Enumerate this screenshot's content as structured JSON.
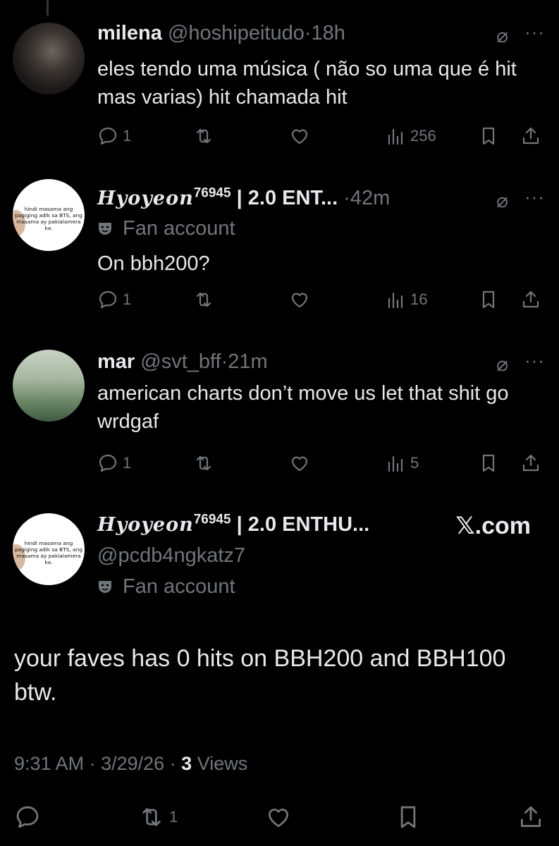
{
  "tweets": [
    {
      "name": "milena",
      "handle": "@hoshipeitudo",
      "sep": "·",
      "time": "18h",
      "text": "eles tendo uma música ( não so uma que é hit mas varias) hit chamada hit",
      "replies": "1",
      "reposts": "",
      "views": "256"
    },
    {
      "name": "Hyoyeon",
      "name_sup": "76945",
      "name_suffix": "| 2.0 ENT...",
      "sep": "·",
      "time": "42m",
      "label": "Fan account",
      "avatar_text": "hindi masama ang pagiging adik sa BTS, ang masama ay pakialamera ka.",
      "text": "On bbh200?",
      "replies": "1",
      "views": "16"
    },
    {
      "name": "mar",
      "handle": "@svt_bff",
      "sep": "·",
      "time": "21m",
      "text": "american charts don’t move us let that shit go wrdgaf",
      "replies": "1",
      "views": "5"
    }
  ],
  "main": {
    "name": "Hyoyeon",
    "name_sup": "76945",
    "name_suffix": "| 2.0 ENTHU...",
    "handle": "@pcdb4ngkatz7",
    "label": "Fan account",
    "avatar_text": "hindi masama ang pagiging adik sa BTS, ang masama ay pakialamera ka.",
    "watermark": "𝕏.com",
    "text": "your faves has 0 hits on BBH200 and BBH100 btw.",
    "time": "9:31 AM",
    "date": "3/29/26",
    "views_count": "3",
    "views_label": "Views",
    "reposts": "1"
  },
  "colors": {
    "background": "#000000",
    "text": "#e7e9ea",
    "muted": "#71767b"
  }
}
